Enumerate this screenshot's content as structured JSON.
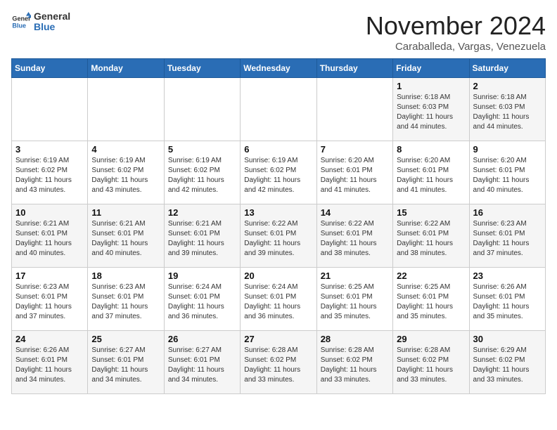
{
  "logo": {
    "line1": "General",
    "line2": "Blue"
  },
  "header": {
    "month": "November 2024",
    "location": "Caraballeda, Vargas, Venezuela"
  },
  "weekdays": [
    "Sunday",
    "Monday",
    "Tuesday",
    "Wednesday",
    "Thursday",
    "Friday",
    "Saturday"
  ],
  "weeks": [
    [
      {
        "day": "",
        "sunrise": "",
        "sunset": "",
        "daylight": ""
      },
      {
        "day": "",
        "sunrise": "",
        "sunset": "",
        "daylight": ""
      },
      {
        "day": "",
        "sunrise": "",
        "sunset": "",
        "daylight": ""
      },
      {
        "day": "",
        "sunrise": "",
        "sunset": "",
        "daylight": ""
      },
      {
        "day": "",
        "sunrise": "",
        "sunset": "",
        "daylight": ""
      },
      {
        "day": "1",
        "sunrise": "Sunrise: 6:18 AM",
        "sunset": "Sunset: 6:03 PM",
        "daylight": "Daylight: 11 hours and 44 minutes."
      },
      {
        "day": "2",
        "sunrise": "Sunrise: 6:18 AM",
        "sunset": "Sunset: 6:03 PM",
        "daylight": "Daylight: 11 hours and 44 minutes."
      }
    ],
    [
      {
        "day": "3",
        "sunrise": "Sunrise: 6:19 AM",
        "sunset": "Sunset: 6:02 PM",
        "daylight": "Daylight: 11 hours and 43 minutes."
      },
      {
        "day": "4",
        "sunrise": "Sunrise: 6:19 AM",
        "sunset": "Sunset: 6:02 PM",
        "daylight": "Daylight: 11 hours and 43 minutes."
      },
      {
        "day": "5",
        "sunrise": "Sunrise: 6:19 AM",
        "sunset": "Sunset: 6:02 PM",
        "daylight": "Daylight: 11 hours and 42 minutes."
      },
      {
        "day": "6",
        "sunrise": "Sunrise: 6:19 AM",
        "sunset": "Sunset: 6:02 PM",
        "daylight": "Daylight: 11 hours and 42 minutes."
      },
      {
        "day": "7",
        "sunrise": "Sunrise: 6:20 AM",
        "sunset": "Sunset: 6:01 PM",
        "daylight": "Daylight: 11 hours and 41 minutes."
      },
      {
        "day": "8",
        "sunrise": "Sunrise: 6:20 AM",
        "sunset": "Sunset: 6:01 PM",
        "daylight": "Daylight: 11 hours and 41 minutes."
      },
      {
        "day": "9",
        "sunrise": "Sunrise: 6:20 AM",
        "sunset": "Sunset: 6:01 PM",
        "daylight": "Daylight: 11 hours and 40 minutes."
      }
    ],
    [
      {
        "day": "10",
        "sunrise": "Sunrise: 6:21 AM",
        "sunset": "Sunset: 6:01 PM",
        "daylight": "Daylight: 11 hours and 40 minutes."
      },
      {
        "day": "11",
        "sunrise": "Sunrise: 6:21 AM",
        "sunset": "Sunset: 6:01 PM",
        "daylight": "Daylight: 11 hours and 40 minutes."
      },
      {
        "day": "12",
        "sunrise": "Sunrise: 6:21 AM",
        "sunset": "Sunset: 6:01 PM",
        "daylight": "Daylight: 11 hours and 39 minutes."
      },
      {
        "day": "13",
        "sunrise": "Sunrise: 6:22 AM",
        "sunset": "Sunset: 6:01 PM",
        "daylight": "Daylight: 11 hours and 39 minutes."
      },
      {
        "day": "14",
        "sunrise": "Sunrise: 6:22 AM",
        "sunset": "Sunset: 6:01 PM",
        "daylight": "Daylight: 11 hours and 38 minutes."
      },
      {
        "day": "15",
        "sunrise": "Sunrise: 6:22 AM",
        "sunset": "Sunset: 6:01 PM",
        "daylight": "Daylight: 11 hours and 38 minutes."
      },
      {
        "day": "16",
        "sunrise": "Sunrise: 6:23 AM",
        "sunset": "Sunset: 6:01 PM",
        "daylight": "Daylight: 11 hours and 37 minutes."
      }
    ],
    [
      {
        "day": "17",
        "sunrise": "Sunrise: 6:23 AM",
        "sunset": "Sunset: 6:01 PM",
        "daylight": "Daylight: 11 hours and 37 minutes."
      },
      {
        "day": "18",
        "sunrise": "Sunrise: 6:23 AM",
        "sunset": "Sunset: 6:01 PM",
        "daylight": "Daylight: 11 hours and 37 minutes."
      },
      {
        "day": "19",
        "sunrise": "Sunrise: 6:24 AM",
        "sunset": "Sunset: 6:01 PM",
        "daylight": "Daylight: 11 hours and 36 minutes."
      },
      {
        "day": "20",
        "sunrise": "Sunrise: 6:24 AM",
        "sunset": "Sunset: 6:01 PM",
        "daylight": "Daylight: 11 hours and 36 minutes."
      },
      {
        "day": "21",
        "sunrise": "Sunrise: 6:25 AM",
        "sunset": "Sunset: 6:01 PM",
        "daylight": "Daylight: 11 hours and 35 minutes."
      },
      {
        "day": "22",
        "sunrise": "Sunrise: 6:25 AM",
        "sunset": "Sunset: 6:01 PM",
        "daylight": "Daylight: 11 hours and 35 minutes."
      },
      {
        "day": "23",
        "sunrise": "Sunrise: 6:26 AM",
        "sunset": "Sunset: 6:01 PM",
        "daylight": "Daylight: 11 hours and 35 minutes."
      }
    ],
    [
      {
        "day": "24",
        "sunrise": "Sunrise: 6:26 AM",
        "sunset": "Sunset: 6:01 PM",
        "daylight": "Daylight: 11 hours and 34 minutes."
      },
      {
        "day": "25",
        "sunrise": "Sunrise: 6:27 AM",
        "sunset": "Sunset: 6:01 PM",
        "daylight": "Daylight: 11 hours and 34 minutes."
      },
      {
        "day": "26",
        "sunrise": "Sunrise: 6:27 AM",
        "sunset": "Sunset: 6:01 PM",
        "daylight": "Daylight: 11 hours and 34 minutes."
      },
      {
        "day": "27",
        "sunrise": "Sunrise: 6:28 AM",
        "sunset": "Sunset: 6:02 PM",
        "daylight": "Daylight: 11 hours and 33 minutes."
      },
      {
        "day": "28",
        "sunrise": "Sunrise: 6:28 AM",
        "sunset": "Sunset: 6:02 PM",
        "daylight": "Daylight: 11 hours and 33 minutes."
      },
      {
        "day": "29",
        "sunrise": "Sunrise: 6:28 AM",
        "sunset": "Sunset: 6:02 PM",
        "daylight": "Daylight: 11 hours and 33 minutes."
      },
      {
        "day": "30",
        "sunrise": "Sunrise: 6:29 AM",
        "sunset": "Sunset: 6:02 PM",
        "daylight": "Daylight: 11 hours and 33 minutes."
      }
    ]
  ]
}
